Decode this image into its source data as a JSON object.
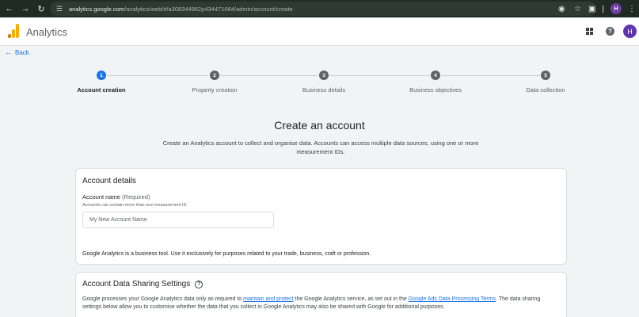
{
  "browser": {
    "url_domain": "analytics.google.com",
    "url_path": "/analytics/web/#/a308344962p434471064/admin/account/create",
    "back_icon": "arrow-left-icon",
    "forward_icon": "arrow-right-icon",
    "reload_icon": "reload-icon",
    "profile_initial": "H"
  },
  "app": {
    "name": "Analytics",
    "avatar_initial": "H",
    "help_glyph": "?"
  },
  "nav": {
    "back_label": "Back"
  },
  "stepper": {
    "steps": [
      {
        "number": "1",
        "label": "Account creation",
        "active": true
      },
      {
        "number": "2",
        "label": "Property creation",
        "active": false
      },
      {
        "number": "3",
        "label": "Business details",
        "active": false
      },
      {
        "number": "4",
        "label": "Business objectives",
        "active": false
      },
      {
        "number": "5",
        "label": "Data collection",
        "active": false
      }
    ]
  },
  "page": {
    "title": "Create an account",
    "intro": "Create an Analytics account to collect and organise data. Accounts can access multiple data sources, using one or more measurement IDs."
  },
  "account_details": {
    "title": "Account details",
    "field_label": "Account name",
    "field_required": "(Required)",
    "field_help": "Accounts can contain more than one measurement ID.",
    "input_value": "",
    "input_placeholder": "My New Account Name",
    "note": "Google Analytics is a business tool. Use it exclusively for purposes related to your trade, business, craft or profession."
  },
  "sharing": {
    "title": "Account Data Sharing Settings",
    "help_glyph": "?",
    "body_part1": "Google processes your Google Analytics data only as required to ",
    "link1": "maintain and protect",
    "body_part2": " the Google Analytics service, as set out in the ",
    "link2": "Google Ads Data Processing Terms",
    "body_part3": ". The data sharing settings below allow you to customise whether the data that you collect in Google Analytics may also be shared with Google for additional purposes."
  },
  "colors": {
    "accent": "#1a73e8",
    "logo_orange": "#f9ab00",
    "logo_dark_orange": "#e37400",
    "avatar": "#5e35b1"
  }
}
